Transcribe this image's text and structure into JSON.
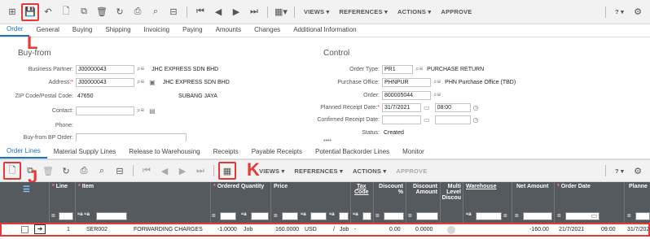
{
  "top_toolbar": {
    "menus": [
      "VIEWS",
      "REFERENCES",
      "ACTIONS",
      "APPROVE"
    ],
    "help": "?"
  },
  "top_tabs": [
    "Order",
    "General",
    "Buying",
    "Shipping",
    "Invoicing",
    "Paying",
    "Amounts",
    "Changes",
    "Additional Information"
  ],
  "buy_from": {
    "title": "Buy-from",
    "business_partner_label": "Business Partner:",
    "business_partner_value": "J00000043",
    "business_partner_name": "JHC EXPRESS SDN BHD",
    "address_label": "Address:",
    "address_value": "J00000043",
    "address_name": "JHC EXPRESS SDN BHD",
    "zip_label": "ZIP Code/Postal Code:",
    "zip_value": "47650",
    "city": "SUBANG JAYA",
    "contact_label": "Contact:",
    "phone_label": "Phone:",
    "buy_from_bp_order_label": "Buy-from BP Order:"
  },
  "control": {
    "title": "Control",
    "order_type_label": "Order Type:",
    "order_type_value": "PR1",
    "order_type_desc": "PURCHASE RETURN",
    "purchase_office_label": "Purchase Office:",
    "purchase_office_value": "PHNPUR",
    "purchase_office_desc": "PHN Purchase Office (TBD)",
    "order_label": "Order:",
    "order_value": "800005044",
    "planned_receipt_label": "Planned Receipt Date:",
    "planned_receipt_date": "31/7/2021",
    "planned_receipt_time": "08:00",
    "confirmed_receipt_label": "Confirmed Receipt Date:",
    "status_label": "Status:",
    "status_value": "Created",
    "more": "••••"
  },
  "sub_tabs": [
    "Order Lines",
    "Material Supply Lines",
    "Release to Warehousing",
    "Receipts",
    "Payable Receipts",
    "Potential Backorder Lines",
    "Monitor"
  ],
  "grid_toolbar": {
    "menus": [
      "VIEWS",
      "REFERENCES",
      "ACTIONS",
      "APPROVE"
    ],
    "help": "?"
  },
  "markers": {
    "L": "L",
    "J": "J",
    "K": "K"
  },
  "grid": {
    "headers": {
      "line": "Line",
      "item": "Item",
      "ordered_quantity": "Ordered Quantity",
      "price": "Price",
      "tax": "Tax",
      "tax2": "Code",
      "discount_pct": "Discount",
      "discount_pct2": "%",
      "discount_amt": "Discount",
      "discount_amt2": "Amount",
      "multi": "Multi",
      "multi2": "Level",
      "multi3": "Discou",
      "warehouse": "Warehouse",
      "net_amount": "Net Amount",
      "order_date": "Order Date",
      "planned": "Planne"
    },
    "row": {
      "line": "1",
      "item": "SER002",
      "description": "FORWARDING CHARGES",
      "quantity": "-1.0000",
      "unit": "Job",
      "price": "160.0000",
      "currency": "USD",
      "per": "/",
      "price_unit": "Job",
      "dash": "-",
      "discount_pct": "0.00",
      "discount_amt": "0.0000",
      "net_amount": "-160.00",
      "order_date": "21/7/2021",
      "order_time": "09:00",
      "planned": "31/7/202"
    }
  },
  "colors": {
    "accent": "#1e73be",
    "highlight": "#e53935",
    "grid_header": "#555a5f"
  }
}
